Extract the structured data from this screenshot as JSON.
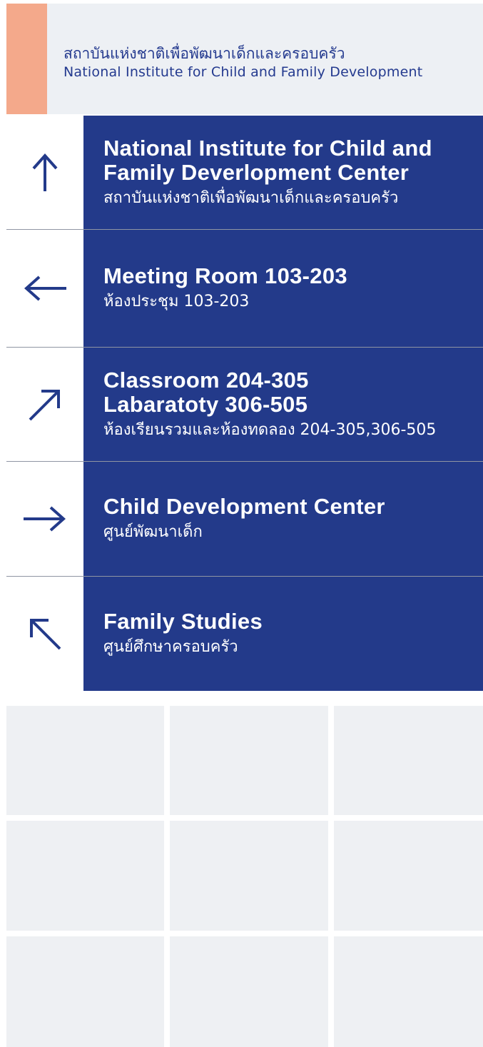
{
  "header": {
    "title_thai": "สถาบันแห่งชาติเพื่อพัฒนาเด็กและครอบครัว",
    "title_en": "National Institute for Child and Family Development"
  },
  "directions": [
    {
      "arrow": "arrow-up-icon",
      "title_lines": [
        "National Institute for Child and",
        "Family Deverlopment Center"
      ],
      "subtitle": "สถาบันแห่งชาติเพื่อพัฒนาเด็กและครอบครัว"
    },
    {
      "arrow": "arrow-left-icon",
      "title_lines": [
        "Meeting Room 103-203"
      ],
      "subtitle": "ห้องประชุม 103-203"
    },
    {
      "arrow": "arrow-up-right-icon",
      "title_lines": [
        "Classroom 204-305",
        "Labaratoty 306-505"
      ],
      "subtitle": "ห้องเรียนรวมและห้องทดลอง 204-305,306-505"
    },
    {
      "arrow": "arrow-right-icon",
      "title_lines": [
        "Child Development Center"
      ],
      "subtitle": "ศูนย์พัฒนาเด็ก"
    },
    {
      "arrow": "arrow-up-left-icon",
      "title_lines": [
        "Family Studies"
      ],
      "subtitle": "ศูนย์ศึกษาครอบครัว"
    }
  ],
  "colors": {
    "navy": "#233a8a",
    "accent": "#f4a98b",
    "header_bg": "#edf0f4",
    "placeholder_bg": "#eef0f3"
  }
}
